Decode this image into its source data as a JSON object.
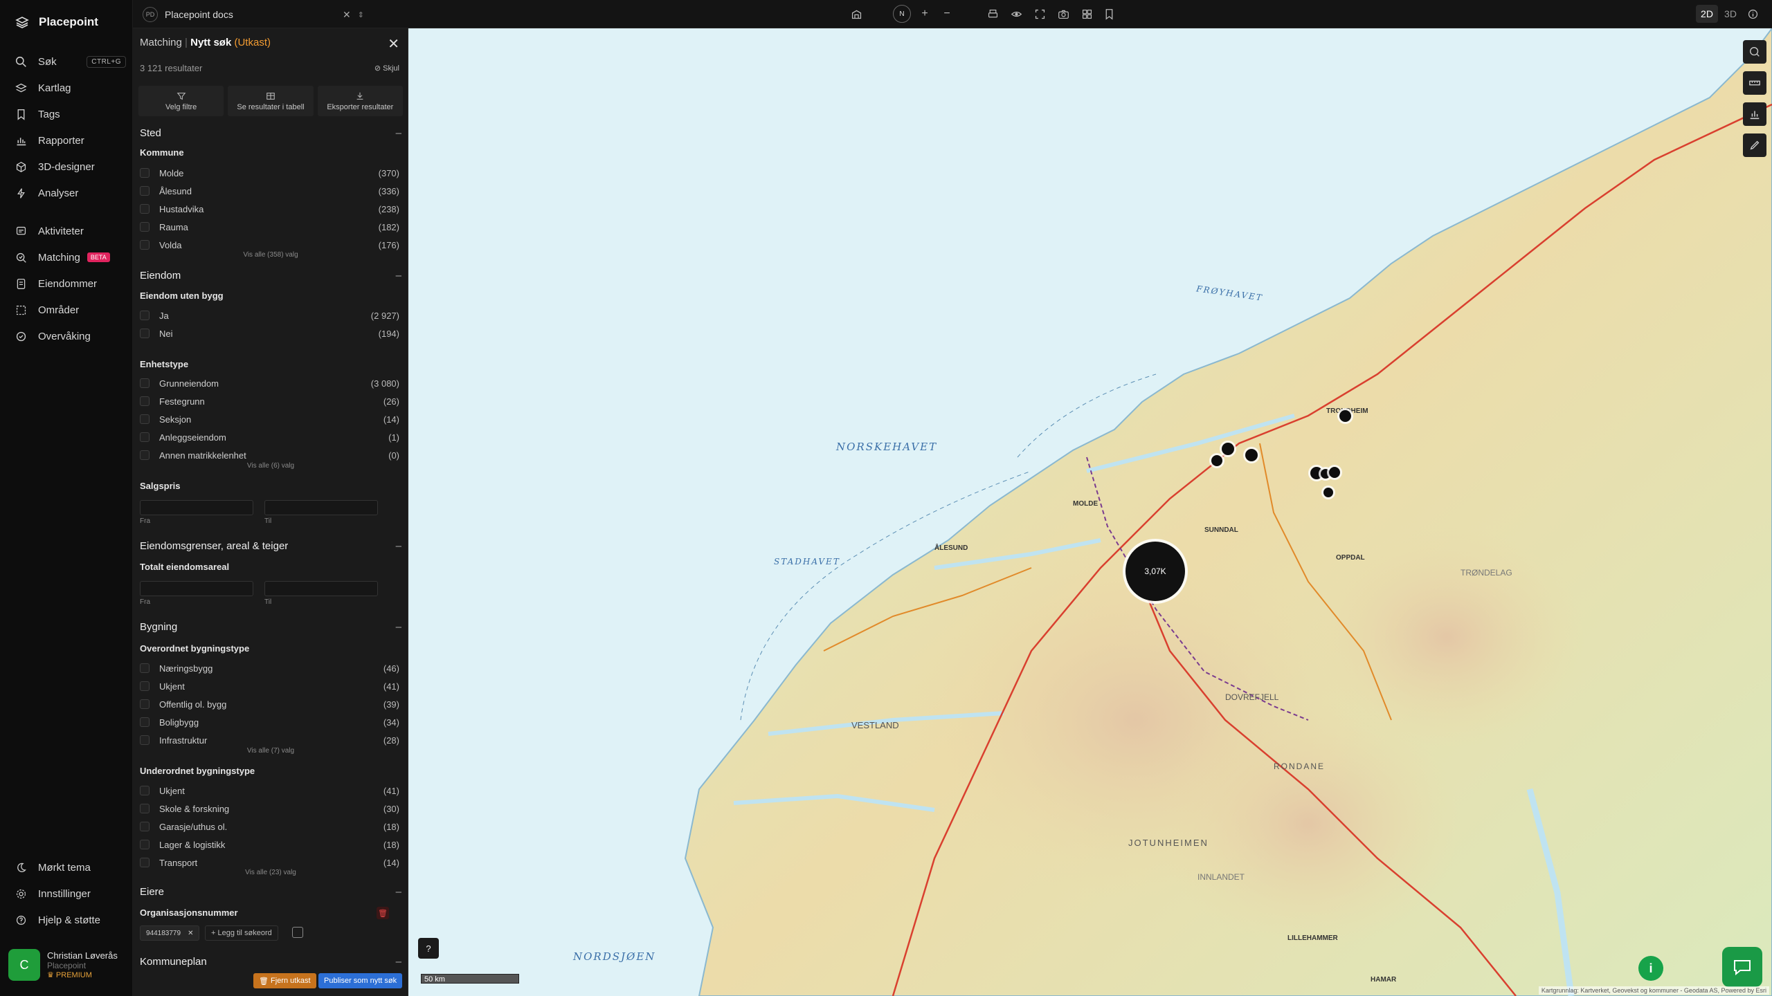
{
  "nav": {
    "brand": "Placepoint",
    "items": [
      {
        "label": "Søk",
        "shortcut": "CTRL+G"
      },
      {
        "label": "Kartlag"
      },
      {
        "label": "Tags"
      },
      {
        "label": "Rapporter"
      },
      {
        "label": "3D-designer"
      },
      {
        "label": "Analyser"
      }
    ],
    "items2": [
      {
        "label": "Aktiviteter"
      },
      {
        "label": "Matching",
        "badge": "BETA"
      },
      {
        "label": "Eiendommer"
      },
      {
        "label": "Områder"
      },
      {
        "label": "Overvåking"
      }
    ],
    "bottom": [
      {
        "label": "Mørkt tema"
      },
      {
        "label": "Innstillinger"
      },
      {
        "label": "Hjelp & støtte"
      }
    ],
    "user": {
      "initial": "C",
      "name": "Christian Løverås",
      "org": "Placepoint",
      "plan": "PREMIUM"
    }
  },
  "topbar": {
    "doc_initials": "PD",
    "doc_name": "Placepoint docs",
    "compass": "N",
    "view_2d": "2D",
    "view_3d": "3D"
  },
  "panel": {
    "crumb_parent": "Matching",
    "crumb_title": "Nytt søk",
    "crumb_status": "(Utkast)",
    "result_count": "3 121 resultater",
    "hide_label": "Skjul",
    "actions": [
      "Velg filtre",
      "Se resultater i tabell",
      "Eksporter resultater"
    ],
    "sections": {
      "sted": "Sted",
      "kommune": "Kommune",
      "kommune_rows": [
        {
          "label": "Molde",
          "count": "(370)"
        },
        {
          "label": "Ålesund",
          "count": "(336)"
        },
        {
          "label": "Hustadvika",
          "count": "(238)"
        },
        {
          "label": "Rauma",
          "count": "(182)"
        },
        {
          "label": "Volda",
          "count": "(176)"
        }
      ],
      "kommune_more": "Vis alle (358) valg",
      "eiendom": "Eiendom",
      "uten_bygg": "Eiendom uten bygg",
      "uten_bygg_rows": [
        {
          "label": "Ja",
          "count": "(2 927)"
        },
        {
          "label": "Nei",
          "count": "(194)"
        }
      ],
      "enhetstype": "Enhetstype",
      "enhetstype_rows": [
        {
          "label": "Grunneiendom",
          "count": "(3 080)"
        },
        {
          "label": "Festegrunn",
          "count": "(26)"
        },
        {
          "label": "Seksjon",
          "count": "(14)"
        },
        {
          "label": "Anleggseiendom",
          "count": "(1)"
        },
        {
          "label": "Annen matrikkelenhet",
          "count": "(0)"
        }
      ],
      "enhetstype_more": "Vis alle (6) valg",
      "salgspris": "Salgspris",
      "fra": "Fra",
      "til": "Til",
      "grenser": "Eiendomsgrenser, areal & teiger",
      "totalt_areal": "Totalt eiendomsareal",
      "bygning": "Bygning",
      "overordnet": "Overordnet bygningstype",
      "overordnet_rows": [
        {
          "label": "Næringsbygg",
          "count": "(46)"
        },
        {
          "label": "Ukjent",
          "count": "(41)"
        },
        {
          "label": "Offentlig ol. bygg",
          "count": "(39)"
        },
        {
          "label": "Boligbygg",
          "count": "(34)"
        },
        {
          "label": "Infrastruktur",
          "count": "(28)"
        }
      ],
      "overordnet_more": "Vis alle (7) valg",
      "underordnet": "Underordnet bygningstype",
      "underordnet_rows": [
        {
          "label": "Ukjent",
          "count": "(41)"
        },
        {
          "label": "Skole & forskning",
          "count": "(30)"
        },
        {
          "label": "Garasje/uthus ol.",
          "count": "(18)"
        },
        {
          "label": "Lager & logistikk",
          "count": "(18)"
        },
        {
          "label": "Transport",
          "count": "(14)"
        }
      ],
      "underordnet_more": "Vis alle (23) valg",
      "eiere": "Eiere",
      "orgnr": "Organisasjonsnummer",
      "orgnr_chip": "944183779",
      "add_keyword": "+ Legg til søkeord",
      "kommuneplan": "Kommuneplan"
    },
    "btn_remove": "Fjern utkast",
    "btn_publish": "Publiser som nytt søk"
  },
  "map": {
    "seas": [
      "NORSKEHAVET",
      "FRØYHAVET",
      "STADHAVET",
      "NORDSJØEN"
    ],
    "cluster_label": "3,07K",
    "scale_label": "50 km",
    "attribution": "Kartgrunnlag: Kartverket, Geovekst og kommuner - Geodata AS, Powered by Esri",
    "places": [
      "TRONDHEIM",
      "MOLDE",
      "ÅLESUND",
      "VESTLAND",
      "DOVREFJELL",
      "JOTUNHEIMEN",
      "RONDANE",
      "INNLANDET",
      "TRØNDELAG",
      "HAMAR",
      "LILLEHAMMER",
      "OPPDAL",
      "SUNNDAL"
    ]
  },
  "colors": {
    "accent": "#f39c32",
    "primary": "#2c6fd6",
    "brand_green": "#1a9a46"
  }
}
